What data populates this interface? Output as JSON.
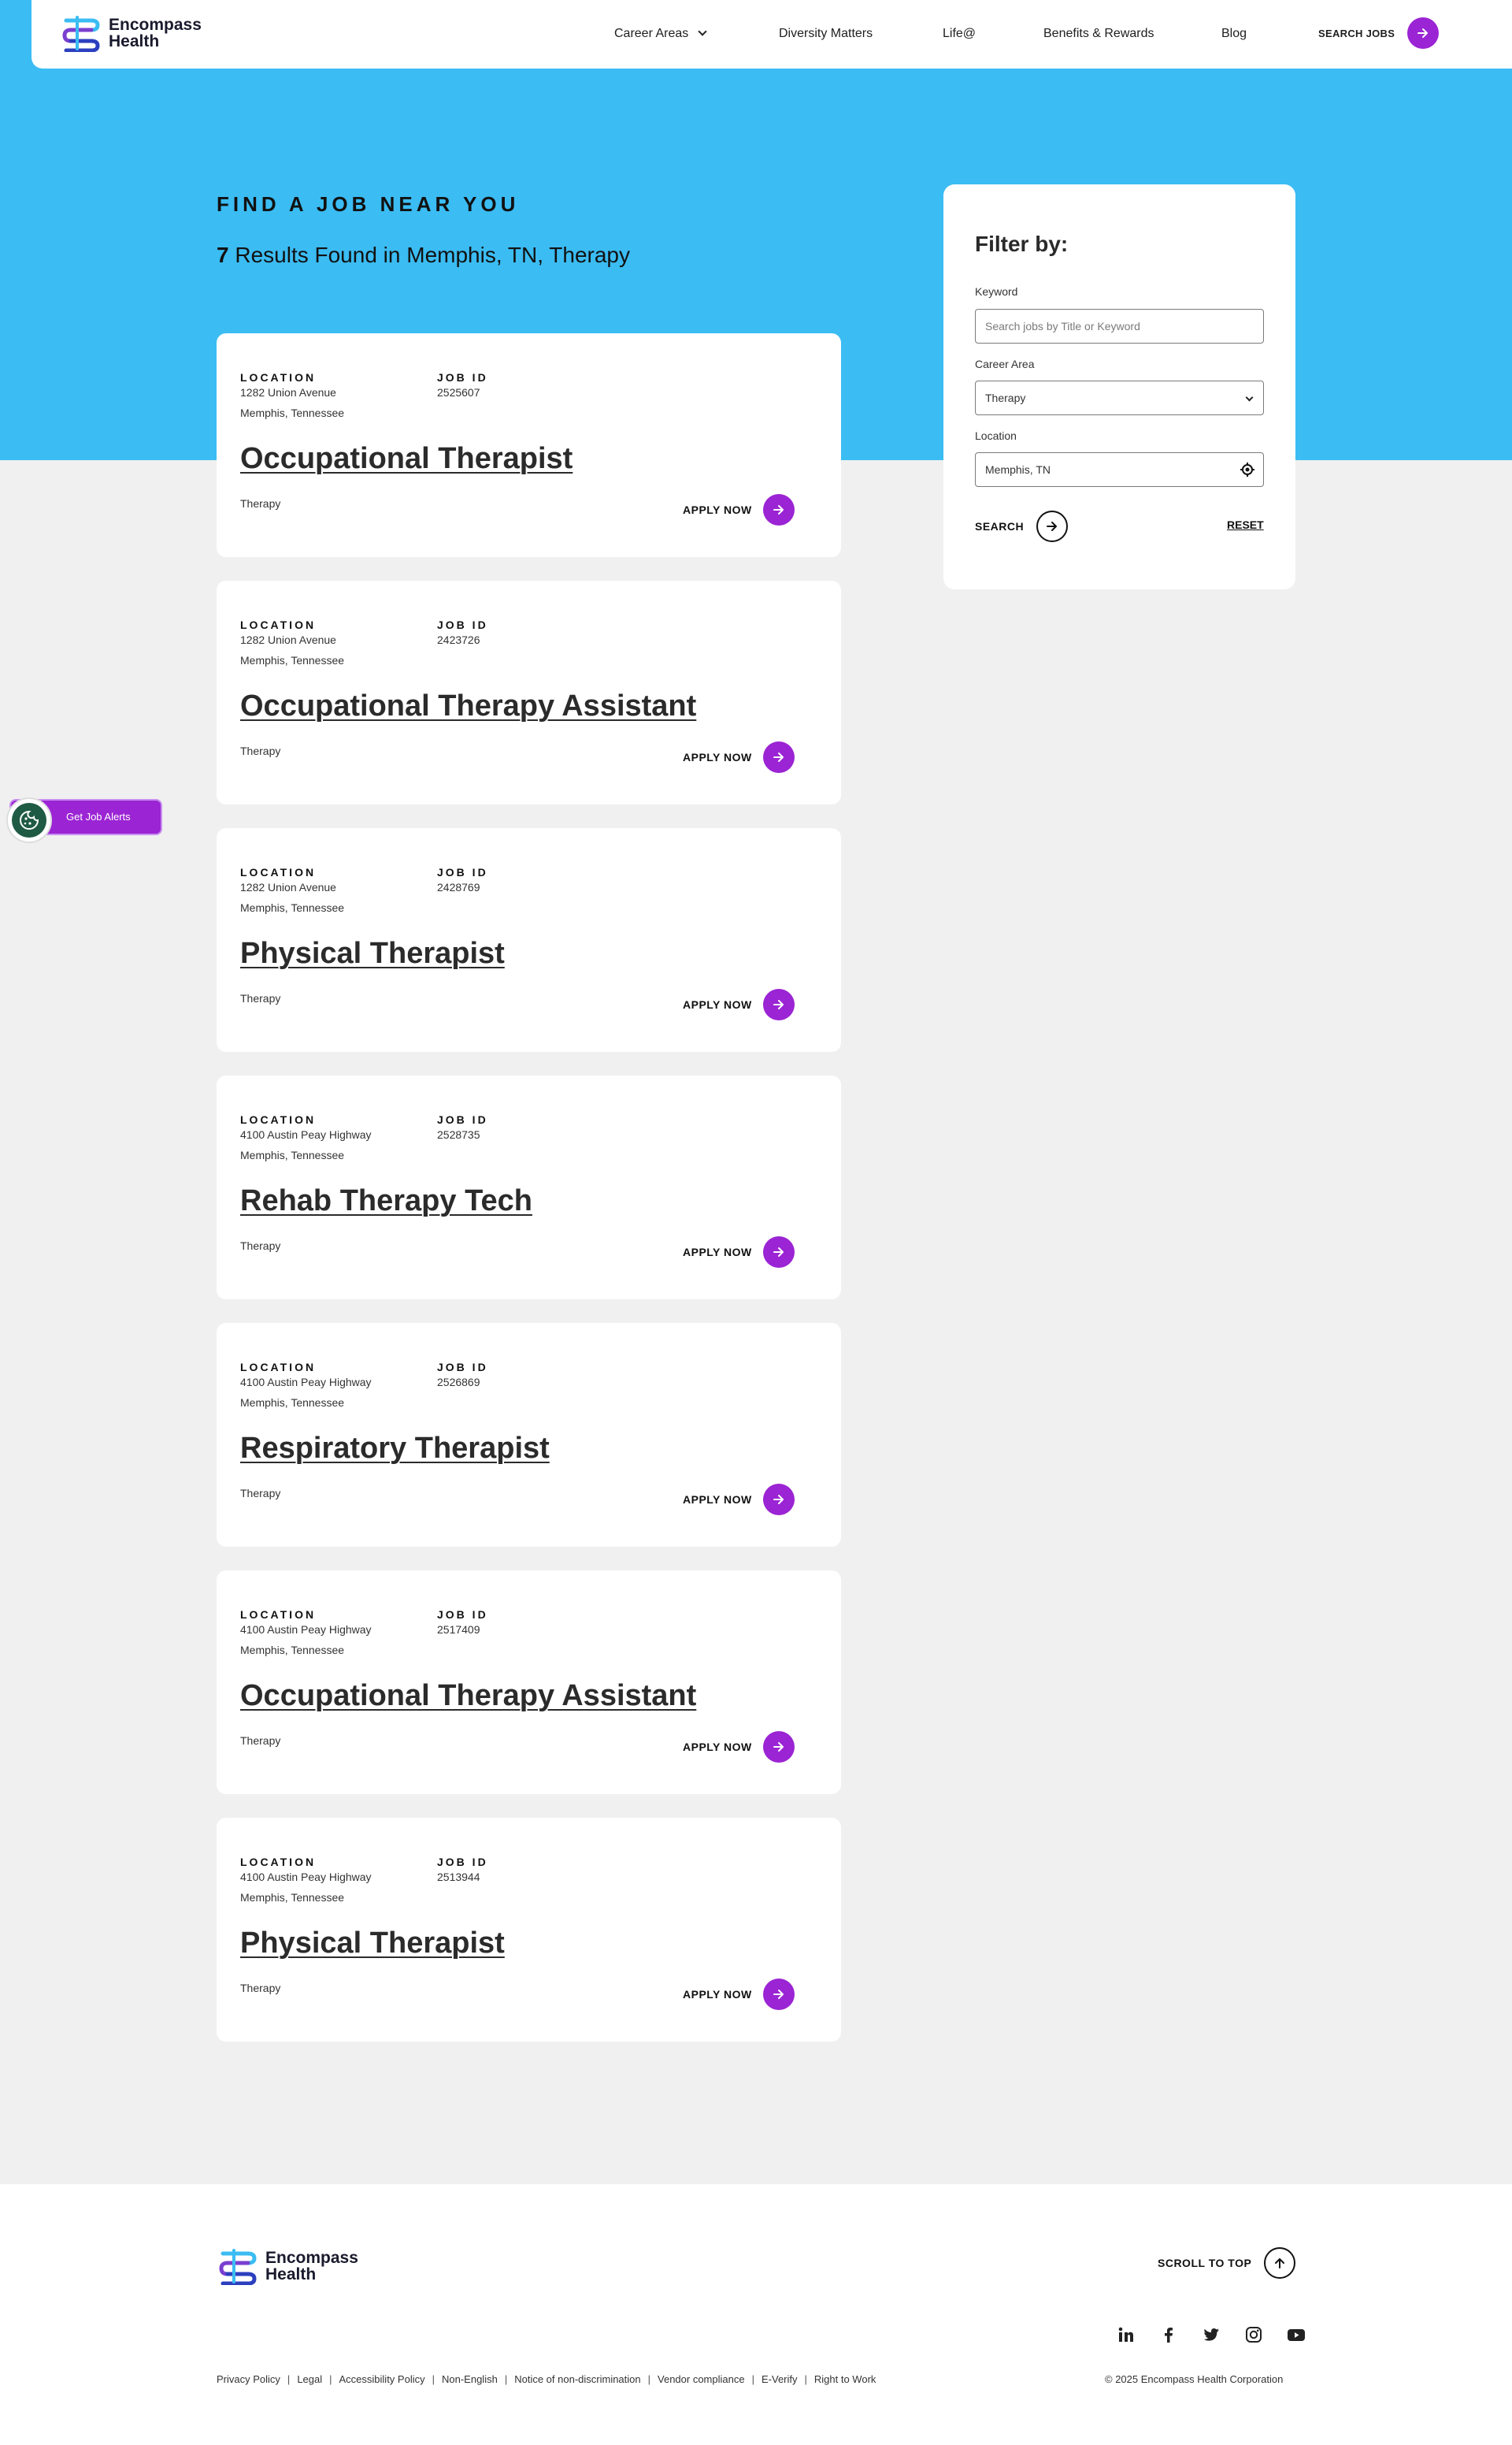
{
  "header": {
    "logo_line1": "Encompass",
    "logo_line2": "Health",
    "nav": [
      {
        "label": "Career Areas",
        "has_dropdown": true
      },
      {
        "label": "Diversity Matters"
      },
      {
        "label": "Life@"
      },
      {
        "label": "Benefits & Rewards"
      },
      {
        "label": "Blog"
      }
    ],
    "search_jobs_label": "SEARCH JOBS"
  },
  "hero": {
    "heading": "FIND A JOB NEAR YOU",
    "results_count": "7",
    "results_text": " Results Found in Memphis, TN, Therapy"
  },
  "card_labels": {
    "location": "LOCATION",
    "job_id": "JOB ID",
    "apply": "APPLY NOW"
  },
  "jobs": [
    {
      "address1": "1282 Union Avenue",
      "address2": "Memphis, Tennessee",
      "job_id": "2525607",
      "title": "Occupational Therapist",
      "category": "Therapy"
    },
    {
      "address1": "1282 Union Avenue",
      "address2": "Memphis, Tennessee",
      "job_id": "2423726",
      "title": "Occupational Therapy Assistant",
      "category": "Therapy"
    },
    {
      "address1": "1282 Union Avenue",
      "address2": "Memphis, Tennessee",
      "job_id": "2428769",
      "title": "Physical Therapist",
      "category": "Therapy"
    },
    {
      "address1": "4100 Austin Peay Highway",
      "address2": "Memphis, Tennessee",
      "job_id": "2528735",
      "title": "Rehab Therapy Tech",
      "category": "Therapy"
    },
    {
      "address1": "4100 Austin Peay Highway",
      "address2": "Memphis, Tennessee",
      "job_id": "2526869",
      "title": "Respiratory Therapist",
      "category": "Therapy"
    },
    {
      "address1": "4100 Austin Peay Highway",
      "address2": "Memphis, Tennessee",
      "job_id": "2517409",
      "title": "Occupational Therapy Assistant",
      "category": "Therapy"
    },
    {
      "address1": "4100 Austin Peay Highway",
      "address2": "Memphis, Tennessee",
      "job_id": "2513944",
      "title": "Physical Therapist",
      "category": "Therapy"
    }
  ],
  "filter": {
    "title": "Filter by:",
    "keyword_label": "Keyword",
    "keyword_placeholder": "Search jobs by Title or Keyword",
    "career_area_label": "Career Area",
    "career_area_value": "Therapy",
    "location_label": "Location",
    "location_value": "Memphis, TN",
    "search_label": "SEARCH",
    "reset_label": "RESET"
  },
  "job_alerts": {
    "label": "Get Job Alerts"
  },
  "footer": {
    "logo_line1": "Encompass",
    "logo_line2": "Health",
    "scroll_top_label": "SCROLL TO TOP",
    "socials": [
      "linkedin-icon",
      "facebook-icon",
      "twitter-icon",
      "instagram-icon",
      "youtube-icon"
    ],
    "links": [
      "Privacy Policy",
      "Legal",
      "Accessibility Policy",
      "Non-English",
      "Notice of non-discrimination",
      "Vendor compliance",
      "E-Verify",
      "Right to Work"
    ],
    "copyright": "© 2025 Encompass Health Corporation"
  },
  "colors": {
    "hero_blue": "#3bbcf3",
    "accent_purple": "#9b24d4",
    "page_gray": "#f0f0f0"
  }
}
